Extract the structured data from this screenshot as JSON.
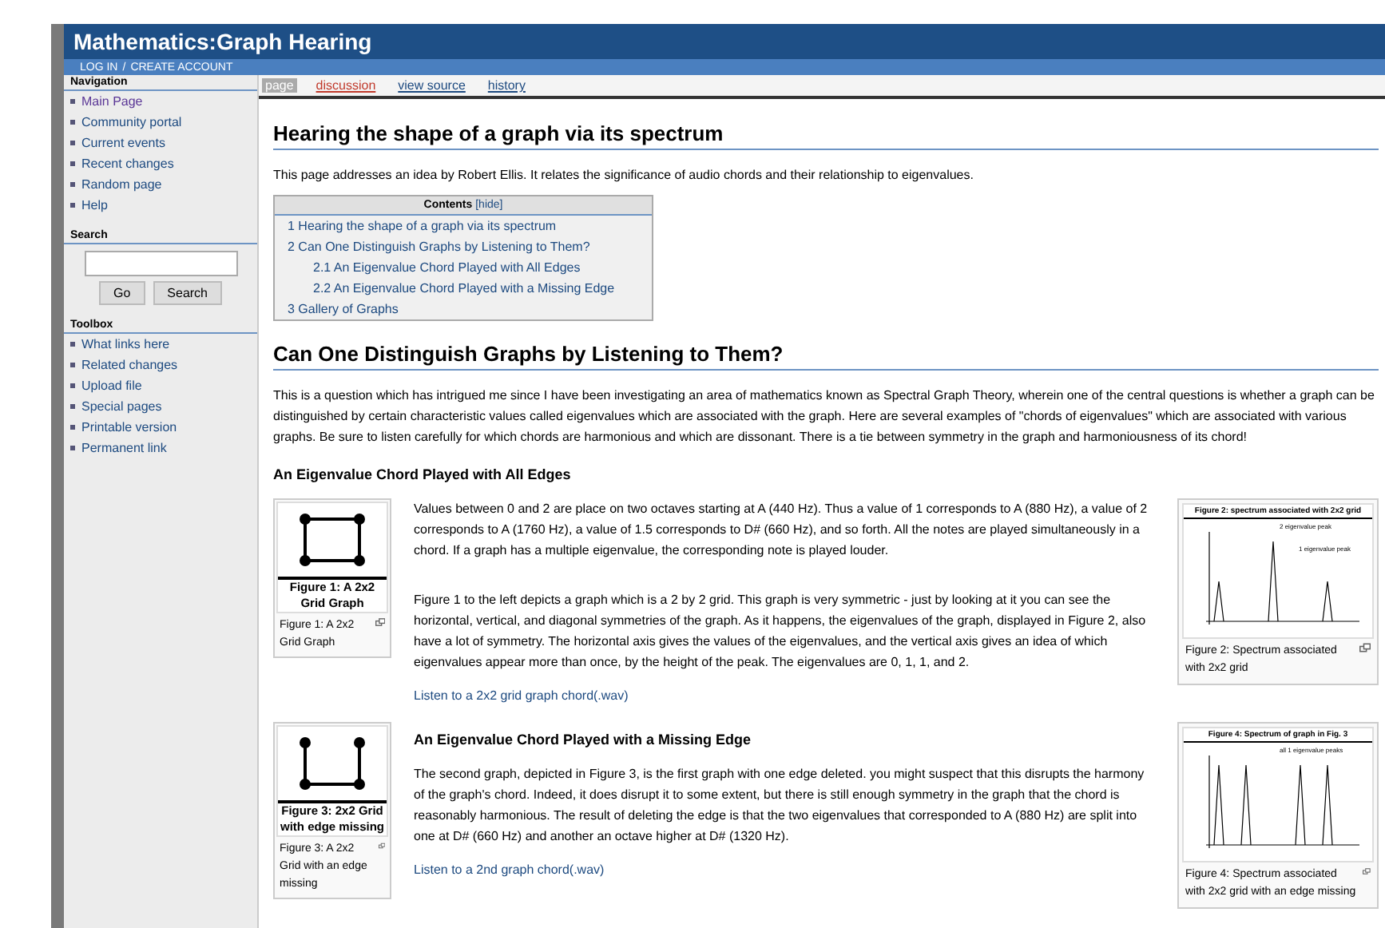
{
  "site_title": "Mathematics:Graph Hearing",
  "account_links": [
    {
      "label": "LOG IN"
    },
    {
      "label": "/"
    },
    {
      "label": "CREATE ACCOUNT"
    }
  ],
  "sidebar": [
    {
      "title": "Navigation",
      "kind": "links",
      "items": [
        {
          "label": "Main Page",
          "visited": true
        },
        {
          "label": "Community portal",
          "visited": false
        },
        {
          "label": "Current events",
          "visited": false
        },
        {
          "label": "Recent changes",
          "visited": false
        },
        {
          "label": "Random page",
          "visited": false
        },
        {
          "label": "Help",
          "visited": false
        }
      ]
    },
    {
      "title": "Search",
      "kind": "search",
      "buttons": [
        "Go",
        "Search"
      ]
    },
    {
      "title": "Toolbox",
      "kind": "links",
      "items": [
        {
          "label": "What links here",
          "visited": false
        },
        {
          "label": "Related changes",
          "visited": false
        },
        {
          "label": "Upload file",
          "visited": false
        },
        {
          "label": "Special pages",
          "visited": false
        },
        {
          "label": "Printable version",
          "visited": false
        },
        {
          "label": "Permanent link",
          "visited": false
        }
      ]
    }
  ],
  "tabs": [
    {
      "label": "page",
      "selected": true,
      "missing": false
    },
    {
      "label": "discussion",
      "selected": false,
      "missing": true
    },
    {
      "label": "view source",
      "selected": false,
      "missing": false
    },
    {
      "label": "history",
      "selected": false,
      "missing": false
    }
  ],
  "heading": "Hearing the shape of a graph via its spectrum",
  "intro": "This page addresses an idea by Robert Ellis. It relates the significance of audio chords and their relationship to eigenvalues.",
  "toc": {
    "title": "Contents",
    "toggle": "[hide]",
    "items": [
      {
        "label": "1 Hearing the shape of a graph via its spectrum"
      },
      {
        "label": "2 Can One Distinguish Graphs by Listening to Them?",
        "children": [
          {
            "label": "2.1 An Eigenvalue Chord Played with All Edges"
          },
          {
            "label": "2.2 An Eigenvalue Chord Played with a Missing Edge"
          }
        ]
      },
      {
        "label": "3 Gallery of Graphs"
      }
    ]
  },
  "section_heading": "Can One Distinguish Graphs by Listening to Them?",
  "section_text": "This is a question which has intrigued me since I have been investigating an area of mathematics known as Spectral Graph Theory, wherein one of the central questions is whether a graph can be distinguished by certain characteristic values called eigenvalues which are associated with the graph. Here are several examples of \"chords of eigenvalues\" which are associated with various graphs. Be sure to listen carefully for which chords are harmonious and which are dissonant. There is a tie between symmetry in the graph and harmoniousness of its chord!",
  "subsections": [
    {
      "heading": "An Eigenvalue Chord Played with All Edges",
      "kind": "above",
      "paragraphs": [
        "Values between 0 and 2 are place on two octaves starting at A (440 Hz). Thus a value of 1 corresponds to A (880 Hz), a value of 2 corresponds to A (1760 Hz), a value of 1.5 corresponds to D# (660 Hz), and so forth. All the notes are played simultaneously in a chord. If a graph has a multiple eigenvalue, the corresponding note is played louder.",
        "Figure 1 to the left depicts a graph which is a 2 by 2 grid. This graph is very symmetric - just by looking at it you can see the horizontal, vertical, and diagonal symmetries of the graph. As it happens, the eigenvalues of the graph, displayed in Figure 2, also have a lot of symmetry. The horizontal axis gives the values of the eigenvalues, and the vertical axis gives an idea of which eigenvalues appear more than once, by the height of the peak. The eigenvalues are 0, 1, 1, and 2."
      ],
      "link": "Listen to a 2x2 grid graph chord(.wav)",
      "left_figure": {
        "image_title": "Figure 1: A 2x2 Grid Graph",
        "caption": "Figure 1: A 2x2 Grid Graph",
        "kind": "square"
      },
      "right_figure": {
        "image_title": "Figure 2: spectrum associated with 2x2 grid",
        "caption": "Figure 2: Spectrum associated with 2x2 grid",
        "notes": [
          "2 eigenvalue peak",
          "1 eigenvalue peak"
        ],
        "kind": "grid"
      }
    },
    {
      "heading": "An Eigenvalue Chord Played with a Missing Edge",
      "kind": "inside",
      "paragraphs": [
        "The second graph, depicted in Figure 3, is the first graph with one edge deleted. you might suspect that this disrupts the harmony of the graph's chord. Indeed, it does disrupt it to some extent, but there is still enough symmetry in the graph that the chord is reasonably harmonious. The result of deleting the edge is that the two eigenvalues that corresponded to A (880 Hz) are split into one at D# (660 Hz) and another an octave higher at D# (1320 Hz)."
      ],
      "link": "Listen to a 2nd graph chord(.wav)",
      "left_figure": {
        "image_title": "Figure 3: 2x2 Grid with edge missing",
        "caption": "Figure 3: A 2x2 Grid with an edge missing",
        "kind": "open"
      },
      "right_figure": {
        "image_title": "Figure 4: Spectrum of graph in Fig. 3",
        "caption": "Figure 4: Spectrum associated with 2x2 grid with an edge missing",
        "notes": [
          "all 1 eigenvalue peaks"
        ],
        "kind": "missing"
      }
    }
  ]
}
